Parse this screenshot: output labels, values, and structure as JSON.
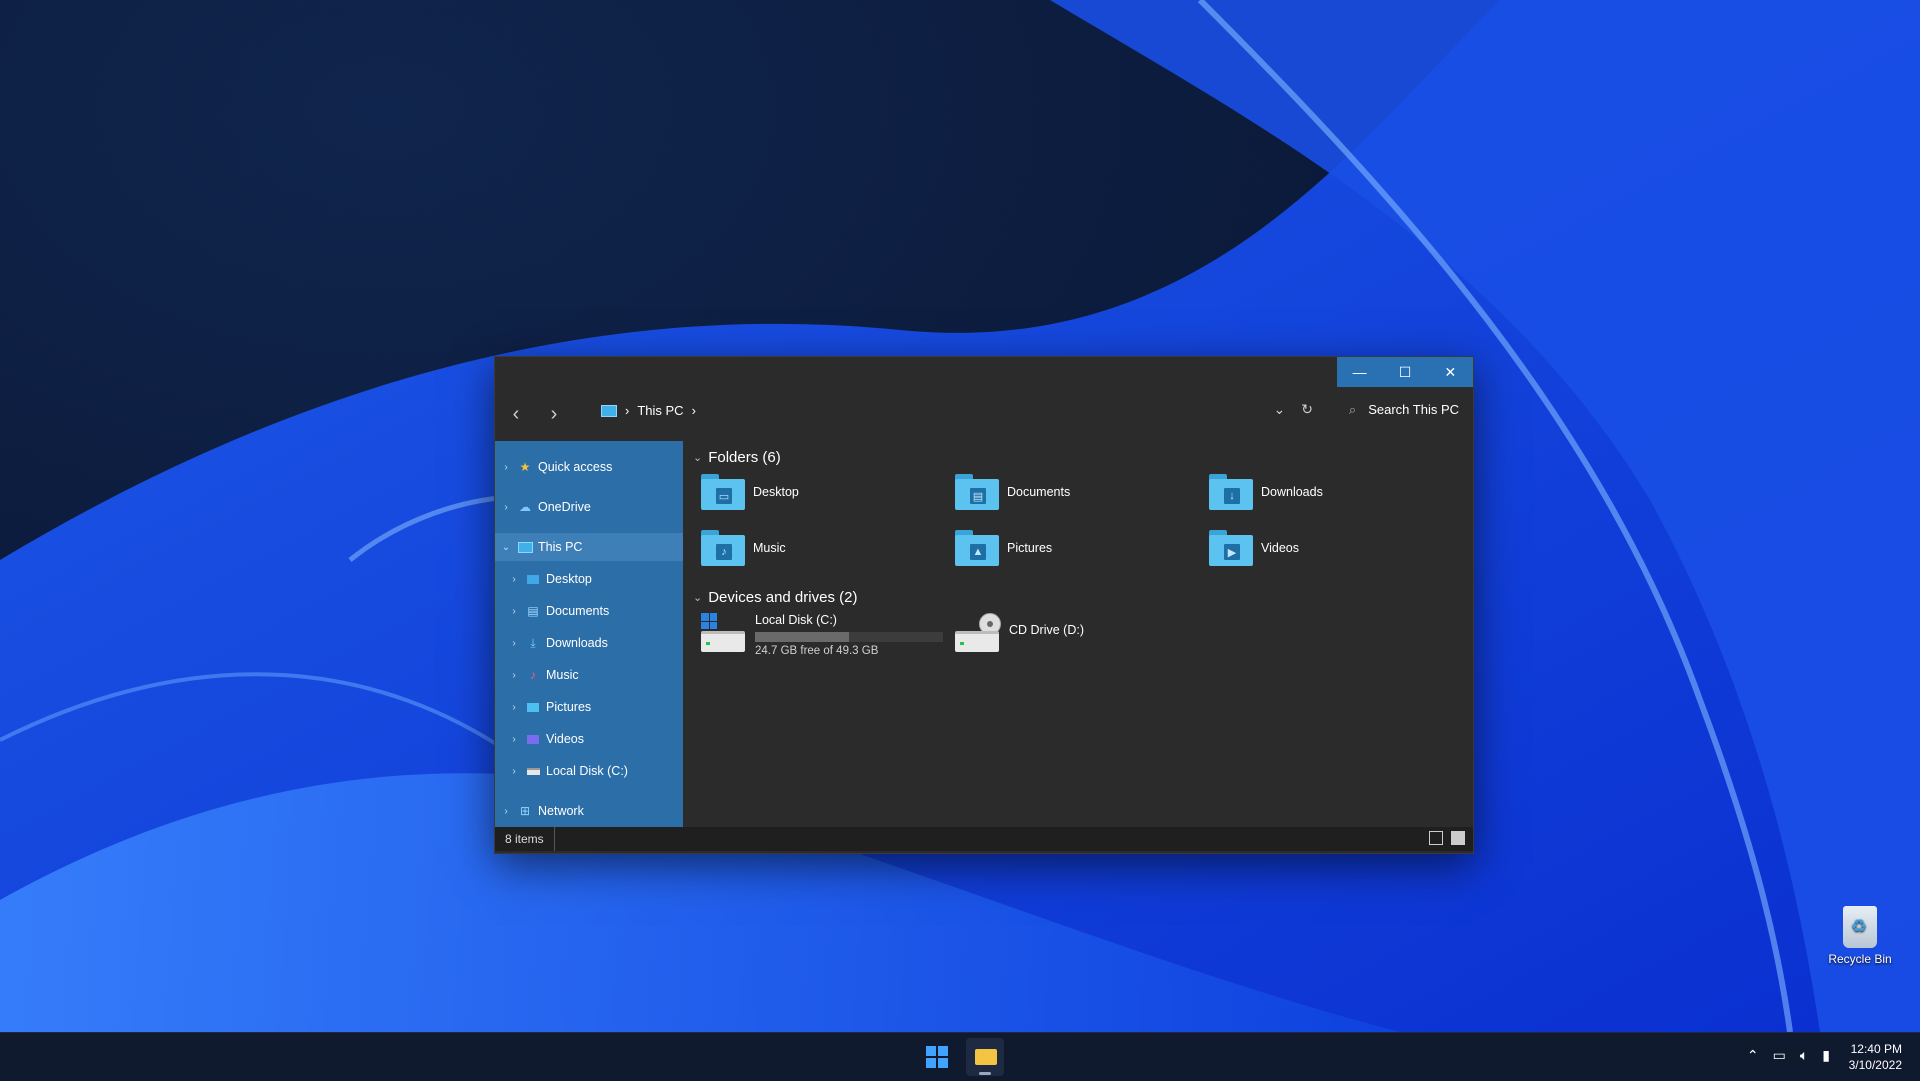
{
  "window": {
    "breadcrumb": [
      "This PC"
    ],
    "search_placeholder": "Search This PC",
    "caption": {
      "minimize": "—",
      "maximize": "☐",
      "close": "✕"
    }
  },
  "sidebar": {
    "items": [
      {
        "label": "Quick access",
        "icon": "star-icon",
        "level": 0
      },
      {
        "label": "OneDrive",
        "icon": "cloud-icon",
        "level": 0
      },
      {
        "label": "This PC",
        "icon": "computer-icon",
        "level": 0,
        "expanded": true,
        "selected": true
      },
      {
        "label": "Desktop",
        "icon": "desktop-icon",
        "level": 1
      },
      {
        "label": "Documents",
        "icon": "document-icon",
        "level": 1
      },
      {
        "label": "Downloads",
        "icon": "download-icon",
        "level": 1
      },
      {
        "label": "Music",
        "icon": "music-icon",
        "level": 1
      },
      {
        "label": "Pictures",
        "icon": "picture-icon",
        "level": 1
      },
      {
        "label": "Videos",
        "icon": "video-icon",
        "level": 1
      },
      {
        "label": "Local Disk (C:)",
        "icon": "drive-icon",
        "level": 1
      },
      {
        "label": "Network",
        "icon": "network-icon",
        "level": 0
      }
    ]
  },
  "content": {
    "folders_header": "Folders (6)",
    "folders": [
      {
        "label": "Desktop",
        "icon": "desktop-folder-icon",
        "glyph": "▭"
      },
      {
        "label": "Documents",
        "icon": "documents-folder-icon",
        "glyph": "▤"
      },
      {
        "label": "Downloads",
        "icon": "downloads-folder-icon",
        "glyph": "↓"
      },
      {
        "label": "Music",
        "icon": "music-folder-icon",
        "glyph": "♪"
      },
      {
        "label": "Pictures",
        "icon": "pictures-folder-icon",
        "glyph": "▲"
      },
      {
        "label": "Videos",
        "icon": "videos-folder-icon",
        "glyph": "▶"
      }
    ],
    "drives_header": "Devices and drives (2)",
    "drives": [
      {
        "label": "Local Disk (C:)",
        "free_text": "24.7 GB free of 49.3 GB",
        "used_fraction": 0.5
      },
      {
        "label": "CD Drive (D:)"
      }
    ]
  },
  "statusbar": {
    "count": "8 items"
  },
  "desktop": {
    "recycle_bin": "Recycle Bin"
  },
  "taskbar": {
    "time": "12:40 PM",
    "date": "3/10/2022"
  },
  "colors": {
    "accent": "#2a71b3",
    "sidebar": "#2c6ea8",
    "window_bg": "#2b2b2b"
  }
}
